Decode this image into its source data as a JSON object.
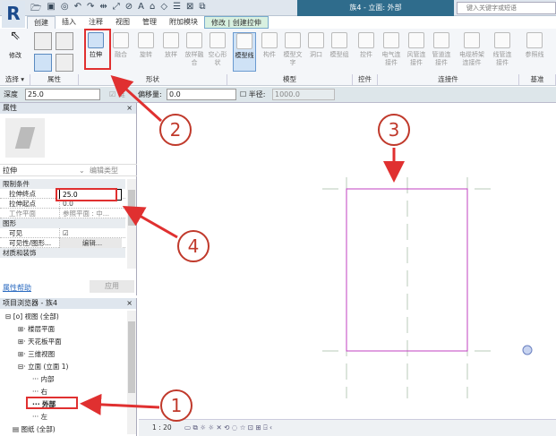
{
  "app": {
    "document_title": "族4 - 立面: 外部",
    "search_placeholder": "键入关键字或短语"
  },
  "tabs": [
    "创建",
    "插入",
    "注释",
    "视图",
    "管理",
    "附加模块",
    "修改 | 创建拉伸"
  ],
  "ribbon": {
    "modify": "修改",
    "tools": [
      {
        "label": "拉伸",
        "enabled": true
      },
      {
        "label": "融合",
        "enabled": false
      },
      {
        "label": "旋转",
        "enabled": false
      },
      {
        "label": "放样",
        "enabled": false
      },
      {
        "label": "放样融合",
        "enabled": false
      },
      {
        "label": "空心形状",
        "enabled": false
      },
      {
        "label": "模型线",
        "enabled": true,
        "selected": true
      },
      {
        "label": "构件",
        "enabled": false
      },
      {
        "label": "模型文字",
        "enabled": false
      },
      {
        "label": "洞口",
        "enabled": false
      },
      {
        "label": "模型组",
        "enabled": false
      },
      {
        "label": "控件",
        "enabled": false
      },
      {
        "label": "电气连接件",
        "enabled": false
      },
      {
        "label": "风管连接件",
        "enabled": false
      },
      {
        "label": "管道连接件",
        "enabled": false
      },
      {
        "label": "电缆桥架连接件",
        "enabled": false
      },
      {
        "label": "线管连接件",
        "enabled": false
      },
      {
        "label": "参照线",
        "enabled": false
      }
    ],
    "panels": [
      "选择 ▾",
      "属性",
      "形状",
      "模型",
      "控件",
      "连接件",
      "基准"
    ]
  },
  "options_bar": {
    "depth_label": "深度",
    "depth_value": "25.0",
    "chain_label": "链",
    "offset_label": "偏移量:",
    "offset_value": "0.0",
    "radius_label": "半径:",
    "radius_value": "1000.0"
  },
  "properties": {
    "title": "属性",
    "close": "×",
    "type_name": "拉伸",
    "edit_type": "编辑类型",
    "groups": [
      {
        "name": "限制条件",
        "rows": [
          {
            "key": "拉伸终点",
            "value": "25.0"
          },
          {
            "key": "拉伸起点",
            "value": "0.0"
          },
          {
            "key": "工作平面",
            "value": "参照平面 : 中..."
          }
        ]
      },
      {
        "name": "图形",
        "rows": [
          {
            "key": "可见",
            "value": "☑"
          },
          {
            "key": "可见性/图形...",
            "value": "编辑..."
          }
        ]
      },
      {
        "name": "材质和装饰",
        "rows": []
      }
    ],
    "help_link": "属性帮助",
    "apply": "应用"
  },
  "browser": {
    "title": "项目浏览器 - 族4",
    "close": "×",
    "items": [
      {
        "label": "视图 (全部)",
        "level": 0,
        "toggle": "⊟"
      },
      {
        "label": "楼层平面",
        "level": 1,
        "toggle": "⊞"
      },
      {
        "label": "天花板平面",
        "level": 1,
        "toggle": "⊞"
      },
      {
        "label": "三维视图",
        "level": 1,
        "toggle": "⊞"
      },
      {
        "label": "立面 (立面 1)",
        "level": 1,
        "toggle": "⊟"
      },
      {
        "label": "内部",
        "level": 2
      },
      {
        "label": "右",
        "level": 2
      },
      {
        "label": "外部",
        "level": 2,
        "selected": true
      },
      {
        "label": "左",
        "level": 2
      },
      {
        "label": "图纸 (全部)",
        "level": 0
      }
    ]
  },
  "status": {
    "scale": "1 : 20"
  },
  "annotations": [
    "1",
    "2",
    "3",
    "4"
  ],
  "colors": {
    "accent": "#c0392b",
    "sketch": "#c040c0",
    "title_bar": "#2f6c8c"
  }
}
